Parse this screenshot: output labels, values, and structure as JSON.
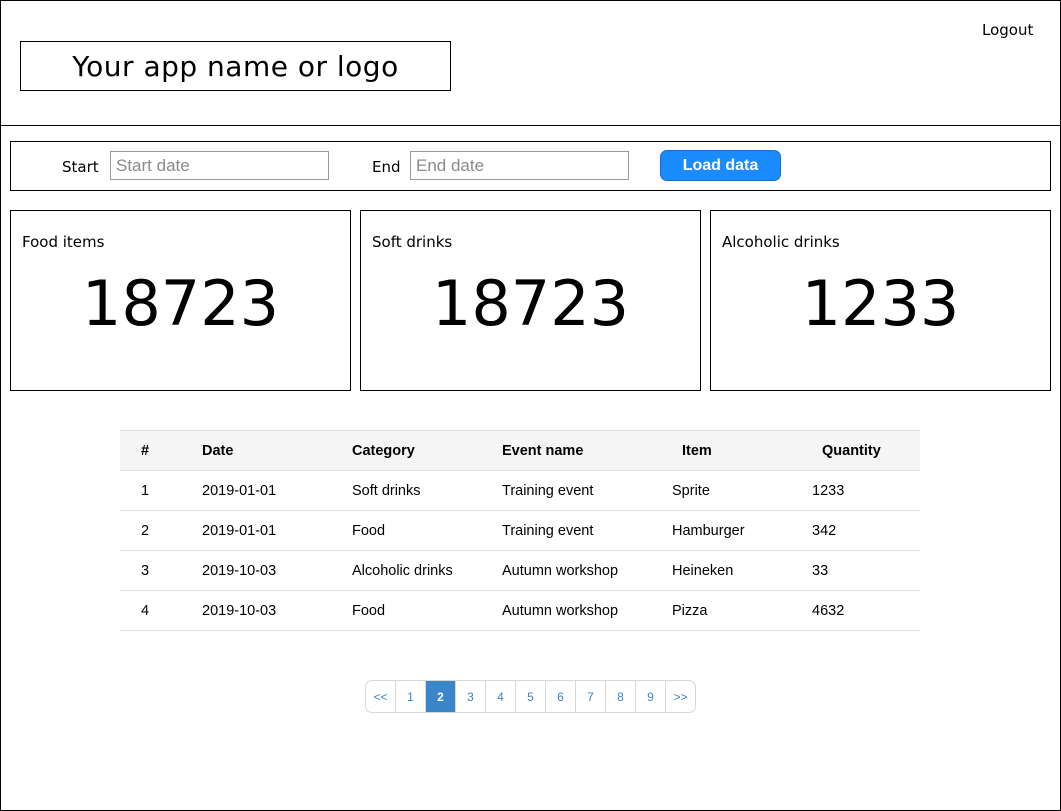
{
  "header": {
    "logo_text": "Your app name or logo",
    "logout_label": "Logout"
  },
  "filters": {
    "start_label": "Start",
    "start_placeholder": "Start date",
    "end_label": "End",
    "end_placeholder": "End date",
    "load_button_label": "Load data",
    "load_button_color": "#1a8cff"
  },
  "cards": [
    {
      "title": "Food items",
      "value": "18723"
    },
    {
      "title": "Soft drinks",
      "value": "18723"
    },
    {
      "title": "Alcoholic drinks",
      "value": "1233"
    }
  ],
  "table": {
    "columns": [
      "#",
      "Date",
      "Category",
      "Event name",
      "Item",
      "Quantity"
    ],
    "rows": [
      [
        "1",
        "2019-01-01",
        "Soft drinks",
        "Training event",
        "Sprite",
        "1233"
      ],
      [
        "2",
        "2019-01-01",
        "Food",
        "Training event",
        "Hamburger",
        "342"
      ],
      [
        "3",
        "2019-10-03",
        "Alcoholic drinks",
        "Autumn workshop",
        "Heineken",
        "33"
      ],
      [
        "4",
        "2019-10-03",
        "Food",
        "Autumn workshop",
        "Pizza",
        "4632"
      ]
    ]
  },
  "pagination": {
    "items": [
      "<<",
      "1",
      "2",
      "3",
      "4",
      "5",
      "6",
      "7",
      "8",
      "9",
      ">>"
    ],
    "active_page": "2",
    "accent_color": "#3a86c8"
  }
}
